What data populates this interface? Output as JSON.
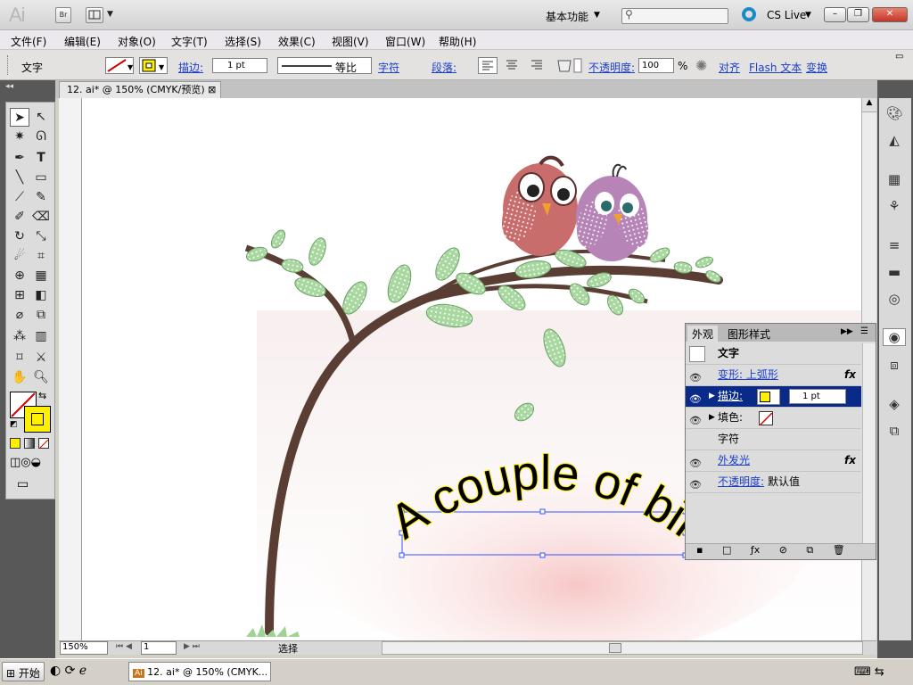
{
  "app": {
    "logo": "Ai",
    "bridge": "Br",
    "workspace": "基本功能",
    "cs_live": "CS Live"
  },
  "window_controls": {
    "minimize": "–",
    "restore": "❐",
    "close": "✕"
  },
  "menu": [
    "文件(F)",
    "编辑(E)",
    "对象(O)",
    "文字(T)",
    "选择(S)",
    "效果(C)",
    "视图(V)",
    "窗口(W)",
    "帮助(H)"
  ],
  "control": {
    "object_type": "文字",
    "stroke_label": "描边:",
    "stroke_weight": "1 pt",
    "stroke_profile": "等比",
    "char_link": "字符",
    "para_label": "段落:",
    "opacity_label": "不透明度:",
    "opacity_value": "100",
    "opacity_unit": "%",
    "align_link": "对齐",
    "flash_link": "Flash 文本",
    "transform_link": "变换"
  },
  "document": {
    "tab": "12. ai* @ 150% (CMYK/预览)",
    "tab_close": "⊠"
  },
  "artwork": {
    "text": "A couple of birds"
  },
  "status": {
    "zoom": "150%",
    "page": "1",
    "mode": "选择"
  },
  "appearance": {
    "tabs": [
      "外观",
      "图形样式"
    ],
    "header": "文字",
    "rows": [
      {
        "label": "变形: 上弧形",
        "fx": "fx",
        "link": true
      },
      {
        "label": "描边:",
        "weight": "1 pt",
        "link": true,
        "selected": true
      },
      {
        "label": "填色:",
        "link": false
      },
      {
        "label": "字符",
        "link": false
      },
      {
        "label": "外发光",
        "fx": "fx",
        "link": true
      },
      {
        "label": "不透明度:",
        "value": "默认值",
        "link": true
      }
    ]
  },
  "taskbar": {
    "start": "开始",
    "task": "12. ai* @ 150% (CMYK..."
  },
  "colors": {
    "fill_yellow": "#ffef00",
    "selection_blue": "#0a2a8a",
    "bark": "#5a3e34",
    "leaf": "#a8d8a0"
  }
}
